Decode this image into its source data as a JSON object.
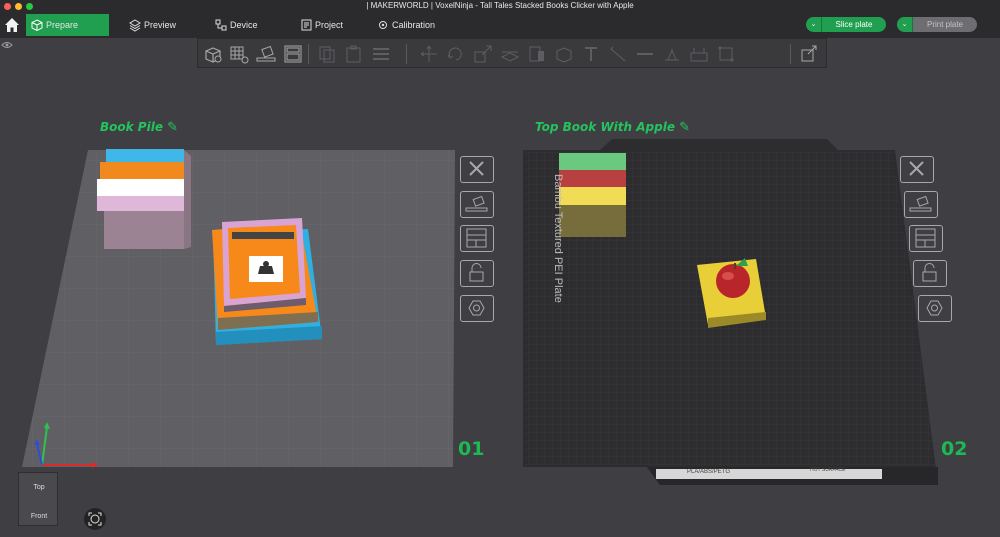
{
  "window": {
    "title": "| MAKERWORLD | VoxelNinja - Tall Tales Stacked Books Clicker with Apple"
  },
  "tabs": [
    {
      "label": "Prepare",
      "icon": "cube-icon",
      "active": true
    },
    {
      "label": "Preview",
      "icon": "layers-icon",
      "active": false
    },
    {
      "label": "Device",
      "icon": "device-icon",
      "active": false
    },
    {
      "label": "Project",
      "icon": "project-icon",
      "active": false
    },
    {
      "label": "Calibration",
      "icon": "calibration-icon",
      "active": false
    }
  ],
  "actions": {
    "slice_label": "Slice plate",
    "print_label": "Print plate"
  },
  "colors": {
    "accent": "#1f9f4f",
    "plate_label": "#23c45e",
    "toolbar_bg": "#3a3a3d",
    "print_disabled": "#6e6e72"
  },
  "toolbar_icons": [
    "add-cube-icon",
    "grid-icon",
    "auto-orient-icon",
    "arrange-icon",
    "copy-icon",
    "paste-icon",
    "split-objects-icon",
    "move-icon",
    "rotate-icon",
    "scale-icon",
    "cut-icon",
    "support-paint-icon",
    "seam-paint-icon",
    "text-icon",
    "measure-icon",
    "color-paint-icon",
    "emboss-icon",
    "boolean-icon",
    "assembly-icon",
    "slice-view-icon"
  ],
  "plates": [
    {
      "label": "Book Pile",
      "number": "01",
      "buttons": [
        "close-icon",
        "auto-orient-plate-icon",
        "arrange-plate-icon",
        "lock-icon",
        "plate-settings-icon"
      ]
    },
    {
      "label": "Top Book With Apple",
      "number": "02",
      "bed_name": "Bambu Textured PEI Plate",
      "bed_tag": "PLA/ABS/PETG",
      "bed_surface": "HOT SURFACE",
      "buttons": [
        "close-icon",
        "auto-orient-plate-icon",
        "arrange-plate-icon",
        "lock-icon",
        "plate-settings-icon"
      ]
    }
  ],
  "navcube": {
    "top": "Top",
    "front": "Front"
  }
}
